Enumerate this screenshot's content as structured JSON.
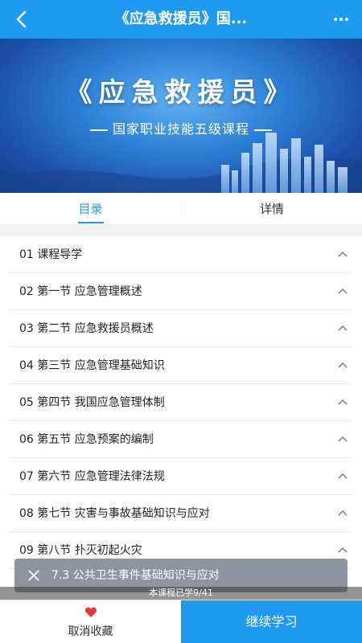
{
  "header": {
    "title": "《应急救援员》国..."
  },
  "banner": {
    "title": "《应急救援员》",
    "subtitle": "国家职业技能五级课程"
  },
  "tabs": [
    {
      "label": "目录",
      "active": true
    },
    {
      "label": "详情",
      "active": false
    }
  ],
  "chapters": [
    {
      "label": "01  课程导学"
    },
    {
      "label": "02  第一节 应急管理概述"
    },
    {
      "label": "03  第二节 应急救援员概述"
    },
    {
      "label": "04  第三节 应急管理基础知识"
    },
    {
      "label": "05  第四节 我国应急管理体制"
    },
    {
      "label": "06  第五节 应急预案的编制"
    },
    {
      "label": "07  第六节 应急管理法律法规"
    },
    {
      "label": "08  第七节 灾害与事故基础知识与应对"
    },
    {
      "label": "09  第八节 扑灭初起火灾"
    }
  ],
  "toast": {
    "text": "7.3 公共卫生事件基础知识与应对"
  },
  "progress": {
    "text": "本课程已学9/41"
  },
  "bottom": {
    "fav_label": "取消收藏",
    "continue_label": "继续学习"
  },
  "colors": {
    "accent": "#1e9bf0",
    "heart": "#e53935"
  },
  "icons": {
    "back": "back-arrow-icon",
    "more": "more-dots-icon",
    "expand": "chevron-up-icon",
    "close": "close-icon",
    "favorite": "heart-icon"
  }
}
